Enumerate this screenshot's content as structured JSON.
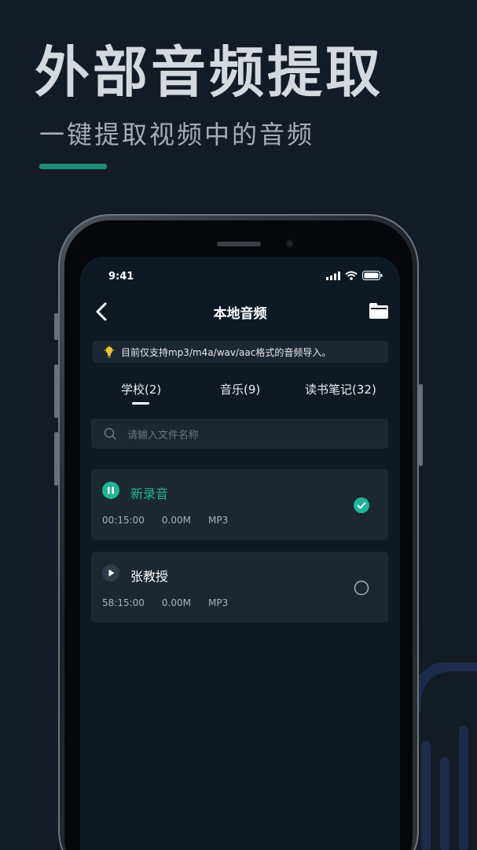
{
  "promo": {
    "headline": "外部音频提取",
    "subline": "一键提取视频中的音频"
  },
  "status_bar": {
    "time": "9:41"
  },
  "nav": {
    "title": "本地音频"
  },
  "tip": {
    "text": "目前仅支持mp3/m4a/wav/aac格式的音频导入。"
  },
  "tabs": [
    {
      "label": "学校(2)",
      "active": true
    },
    {
      "label": "音乐(9)",
      "active": false
    },
    {
      "label": "读书笔记(32)",
      "active": false
    }
  ],
  "search": {
    "placeholder": "请输入文件名称"
  },
  "files": [
    {
      "name": "新录音",
      "duration": "00:15:00",
      "size": "0.00M",
      "format": "MP3",
      "playing": true,
      "selected": true
    },
    {
      "name": "张教授",
      "duration": "58:15:00",
      "size": "0.00M",
      "format": "MP3",
      "playing": false,
      "selected": false
    }
  ],
  "colors": {
    "accent": "#21b49b",
    "background": "#131b26",
    "screen": "#0d1a24",
    "card": "#1b2731"
  }
}
